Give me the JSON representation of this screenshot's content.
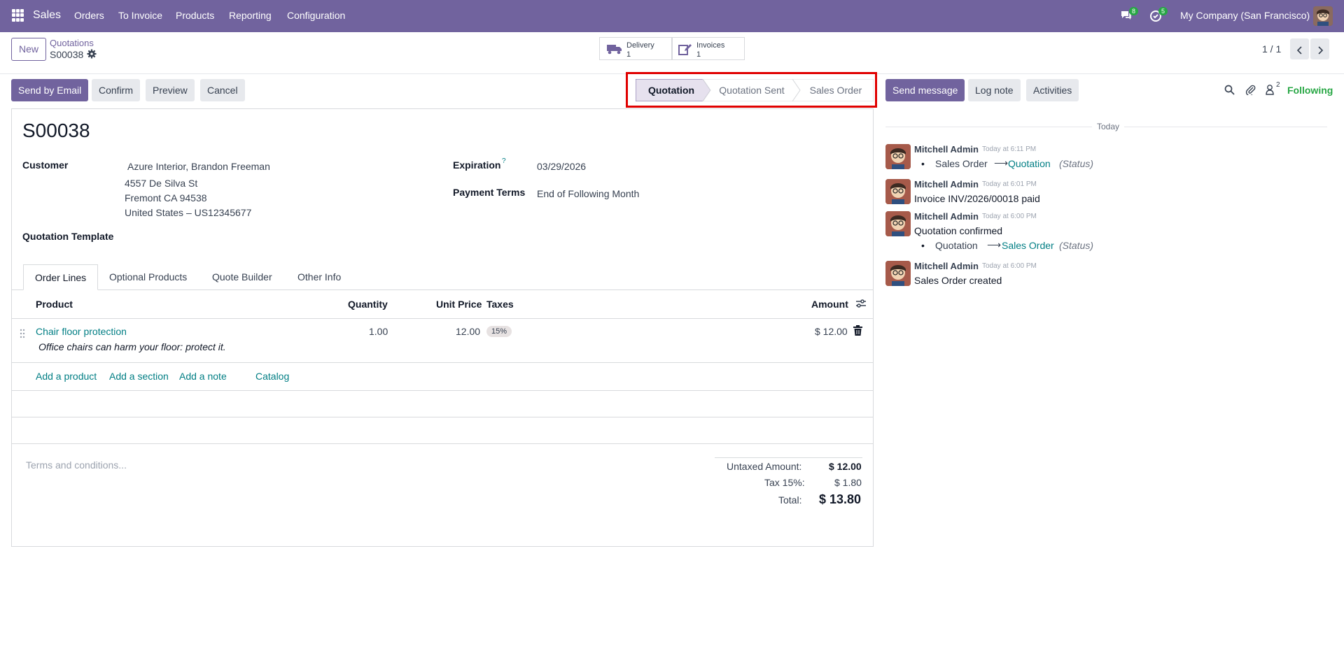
{
  "navbar": {
    "app_name": "Sales",
    "menu": [
      "Orders",
      "To Invoice",
      "Products",
      "Reporting",
      "Configuration"
    ],
    "messages_count": "8",
    "activities_count": "5",
    "company": "My Company (San Francisco)",
    "color": "#71639e"
  },
  "control": {
    "new_label": "New",
    "breadcrumb_parent": "Quotations",
    "record_name": "S00038",
    "smart_buttons": [
      {
        "label": "Delivery",
        "value": "1",
        "icon": "truck-icon"
      },
      {
        "label": "Invoices",
        "value": "1",
        "icon": "edit-icon"
      }
    ],
    "pager": "1 / 1"
  },
  "actions": {
    "send_by_email": "Send by Email",
    "confirm": "Confirm",
    "preview": "Preview",
    "cancel": "Cancel"
  },
  "statusbar": {
    "steps": [
      "Quotation",
      "Quotation Sent",
      "Sales Order"
    ],
    "active_index": 0,
    "highlight_color": "#e00000"
  },
  "form": {
    "title": "S00038",
    "customer_label": "Customer",
    "customer_name": "Azure Interior, Brandon Freeman",
    "address": [
      "4557 De Silva St",
      "Fremont CA 94538",
      "United States – US12345677"
    ],
    "template_label": "Quotation Template",
    "expiration_label": "Expiration",
    "expiration_help": "?",
    "expiration_value": "03/29/2026",
    "payment_terms_label": "Payment Terms",
    "payment_terms_value": "End of Following Month"
  },
  "tabs": [
    "Order Lines",
    "Optional Products",
    "Quote Builder",
    "Other Info"
  ],
  "order_lines": {
    "headers": {
      "product": "Product",
      "quantity": "Quantity",
      "unit_price": "Unit Price",
      "taxes": "Taxes",
      "amount": "Amount"
    },
    "rows": [
      {
        "product": "Chair floor protection",
        "description": "Office chairs can harm your floor: protect it.",
        "quantity": "1.00",
        "unit_price": "12.00",
        "tax": "15%",
        "amount": "$ 12.00"
      }
    ],
    "add_product": "Add a product",
    "add_section": "Add a section",
    "add_note": "Add a note",
    "catalog": "Catalog"
  },
  "terms_placeholder": "Terms and conditions...",
  "totals": {
    "untaxed_label": "Untaxed Amount:",
    "untaxed_value": "$ 12.00",
    "tax_label": "Tax 15%:",
    "tax_value": "$ 1.80",
    "total_label": "Total:",
    "total_value": "$ 13.80"
  },
  "chatter": {
    "send_message": "Send message",
    "log_note": "Log note",
    "activities": "Activities",
    "followers_count": "2",
    "following": "Following",
    "date_separator": "Today",
    "messages": [
      {
        "author": "Mitchell Admin",
        "time": "Today at 6:11 PM",
        "kind": "tracking",
        "from": "Sales Order",
        "to": "Quotation",
        "field": "(Status)"
      },
      {
        "author": "Mitchell Admin",
        "time": "Today at 6:01 PM",
        "kind": "text",
        "body": "Invoice INV/2026/00018 paid"
      },
      {
        "author": "Mitchell Admin",
        "time": "Today at 6:00 PM",
        "kind": "text+tracking",
        "body": "Quotation confirmed",
        "from": "Quotation",
        "to": "Sales Order",
        "field": "(Status)"
      },
      {
        "author": "Mitchell Admin",
        "time": "Today at 6:00 PM",
        "kind": "text",
        "body": "Sales Order created"
      }
    ]
  }
}
